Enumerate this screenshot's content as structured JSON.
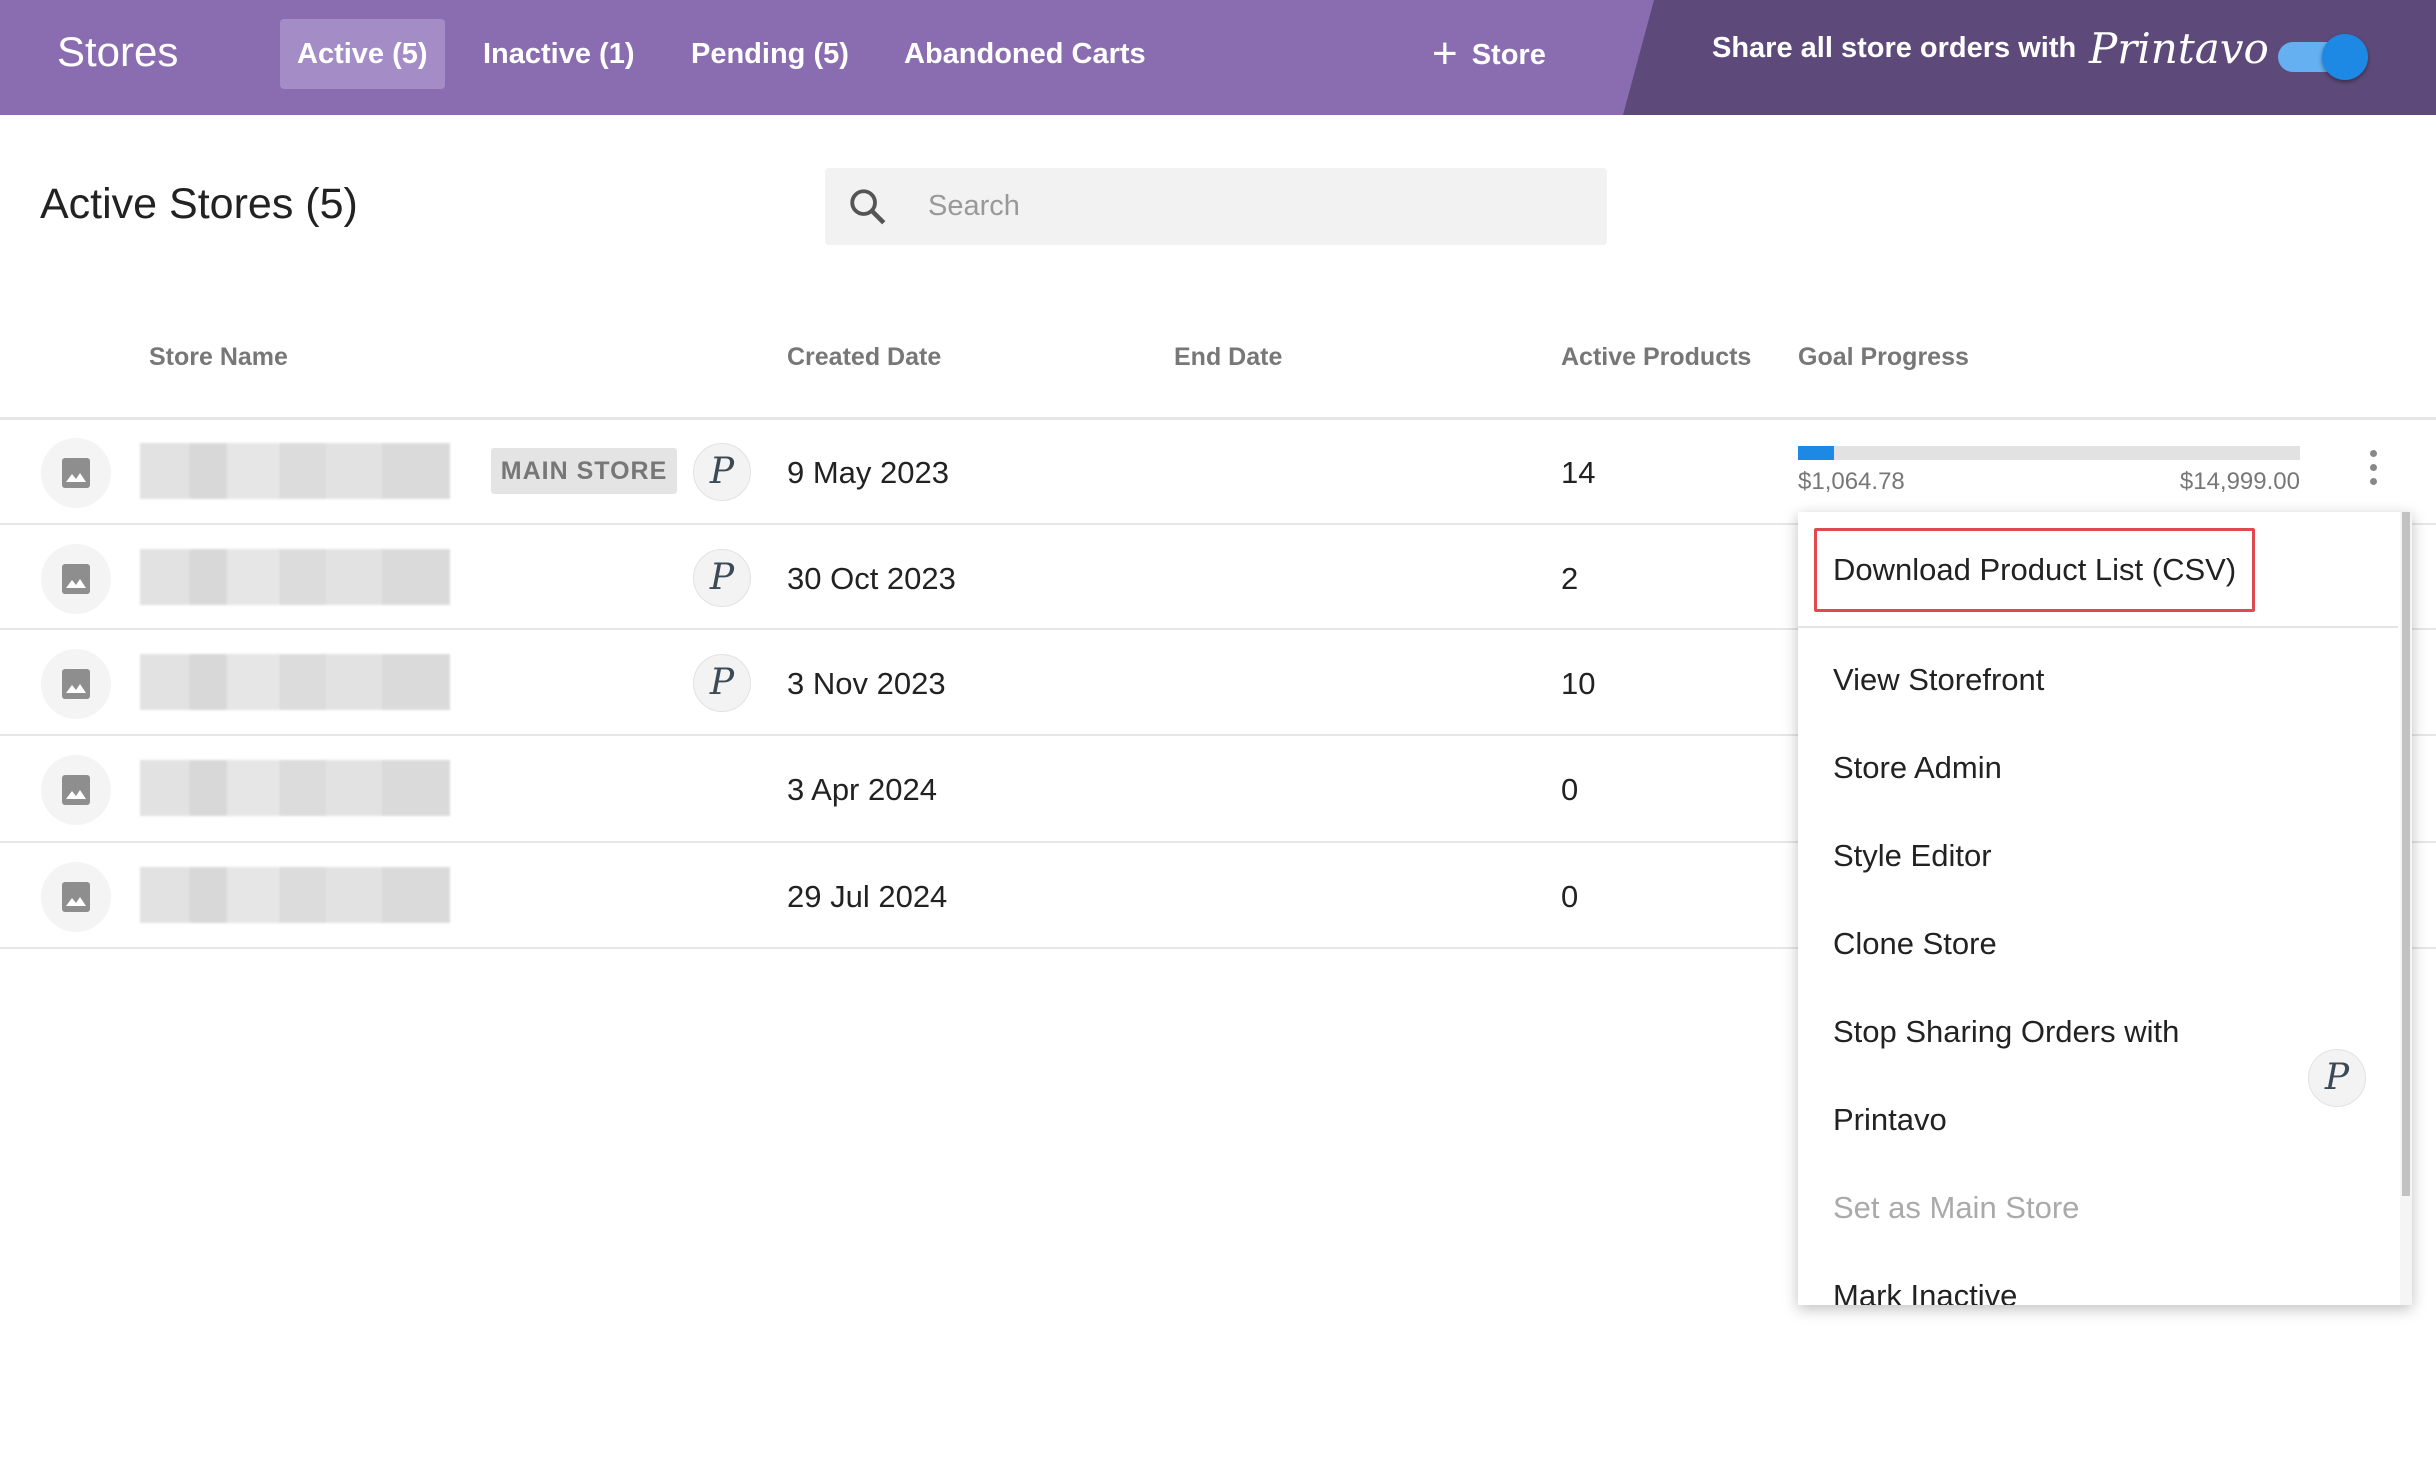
{
  "topbar": {
    "title": "Stores",
    "tabs": [
      {
        "label": "Active (5)",
        "active": true
      },
      {
        "label": "Inactive (1)"
      },
      {
        "label": "Pending (5)"
      },
      {
        "label": "Abandoned Carts"
      }
    ],
    "add_store_label": "Store",
    "share_label": "Share all store orders with",
    "share_brand": "Printavo",
    "share_enabled": true
  },
  "page": {
    "title": "Active Stores (5)",
    "search": {
      "placeholder": "Search",
      "value": ""
    }
  },
  "table": {
    "columns": [
      "Store Name",
      "Created Date",
      "End Date",
      "Active Products",
      "Goal Progress"
    ],
    "rows": [
      {
        "main_store_label": "MAIN STORE",
        "printavo": true,
        "created": "9 May 2023",
        "end": "",
        "active_products": "14",
        "goal": {
          "current": "$1,064.78",
          "target": "$14,999.00",
          "fraction": 0.071
        }
      },
      {
        "printavo": true,
        "created": "30 Oct 2023",
        "end": "",
        "active_products": "2"
      },
      {
        "printavo": true,
        "created": "3 Nov 2023",
        "end": "",
        "active_products": "10"
      },
      {
        "printavo": false,
        "created": "3 Apr 2024",
        "end": "",
        "active_products": "0"
      },
      {
        "printavo": false,
        "created": "29 Jul 2024",
        "end": "",
        "active_products": "0"
      }
    ]
  },
  "menu": {
    "items": [
      {
        "label": "Download Product List (CSV)",
        "highlighted": true
      },
      {
        "label": "View Storefront"
      },
      {
        "label": "Store Admin"
      },
      {
        "label": "Style Editor"
      },
      {
        "label": "Clone Store"
      },
      {
        "label": "Stop Sharing Orders with"
      },
      {
        "label": "Printavo"
      },
      {
        "label": "Set as Main Store",
        "disabled": true
      },
      {
        "label": "Mark Inactive"
      }
    ]
  },
  "colors": {
    "header": "#8a6db0",
    "header_dark": "#5d4a7a",
    "accent": "#1e88e5",
    "highlight_border": "#e04a4f"
  },
  "icons": {
    "printavo": "P"
  }
}
